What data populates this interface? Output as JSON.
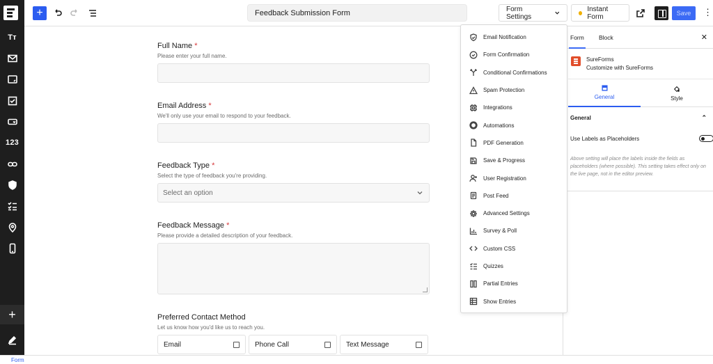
{
  "header": {
    "form_title": "Feedback Submission Form",
    "form_settings_label": "Form Settings",
    "instant_form_label": "Instant Form",
    "save_label": "Save",
    "add_icon": "plus-icon"
  },
  "leftbar": {
    "items": [
      {
        "name": "text-tool",
        "text": "Tт"
      },
      {
        "name": "email-tool"
      },
      {
        "name": "textarea-tool"
      },
      {
        "name": "checkbox-tool"
      },
      {
        "name": "dropdown-tool"
      },
      {
        "name": "number-tool",
        "text": "123"
      },
      {
        "name": "url-tool"
      },
      {
        "name": "gdpr-tool"
      },
      {
        "name": "multichoice-tool"
      },
      {
        "name": "address-tool"
      },
      {
        "name": "phone-tool"
      }
    ],
    "add_label": "+"
  },
  "form": {
    "fields": [
      {
        "label": "Full Name",
        "required": "*",
        "help": "Please enter your full name."
      },
      {
        "label": "Email Address",
        "required": "*",
        "help": "We'll only use your email to respond to your feedback."
      },
      {
        "label": "Feedback Type",
        "required": "*",
        "help": "Select the type of feedback you're providing.",
        "placeholder": "Select an option"
      },
      {
        "label": "Feedback Message",
        "required": "*",
        "help": "Please provide a detailed description of your feedback."
      },
      {
        "label": "Preferred Contact Method",
        "help": "Let us know how you'd like us to reach you.",
        "options": [
          "Email",
          "Phone Call",
          "Text Message"
        ]
      }
    ]
  },
  "settings_menu": {
    "items": [
      {
        "label": "Email Notification",
        "icon": "shield-icon"
      },
      {
        "label": "Form Confirmation",
        "icon": "check-circle-icon"
      },
      {
        "label": "Conditional Confirmations",
        "icon": "branch-icon"
      },
      {
        "label": "Spam Protection",
        "icon": "warning-icon"
      },
      {
        "label": "Integrations",
        "icon": "chip-icon"
      },
      {
        "label": "Automations",
        "icon": "automation-icon"
      },
      {
        "label": "PDF Generation",
        "icon": "file-icon"
      },
      {
        "label": "Save & Progress",
        "icon": "save-icon"
      },
      {
        "label": "User Registration",
        "icon": "user-plus-icon"
      },
      {
        "label": "Post Feed",
        "icon": "document-icon"
      },
      {
        "label": "Advanced Settings",
        "icon": "gear-icon"
      },
      {
        "label": "Survey & Poll",
        "icon": "bar-chart-icon"
      },
      {
        "label": "Custom CSS",
        "icon": "code-icon"
      },
      {
        "label": "Quizzes",
        "icon": "quiz-icon"
      },
      {
        "label": "Partial Entries",
        "icon": "columns-icon"
      },
      {
        "label": "Show Entries",
        "icon": "table-icon"
      }
    ]
  },
  "panel": {
    "tab_form": "Form",
    "tab_block": "Block",
    "brand_title": "SureForms",
    "brand_subtitle": "Customize with SureForms",
    "tab_general": "General",
    "tab_style": "Style",
    "section_title": "General",
    "toggle_label": "Use Labels as Placeholders",
    "toggle_on": false,
    "note": "Above setting will place the labels inside the fields as placeholders (where possible). This setting takes effect only on the live page, not in the editor preview."
  },
  "footer": {
    "breadcrumb": "Form"
  },
  "colors": {
    "accent": "#2b5cf0",
    "sidebar": "#1e1e1e",
    "required": "#d63638",
    "brand": "#e14d2a"
  }
}
